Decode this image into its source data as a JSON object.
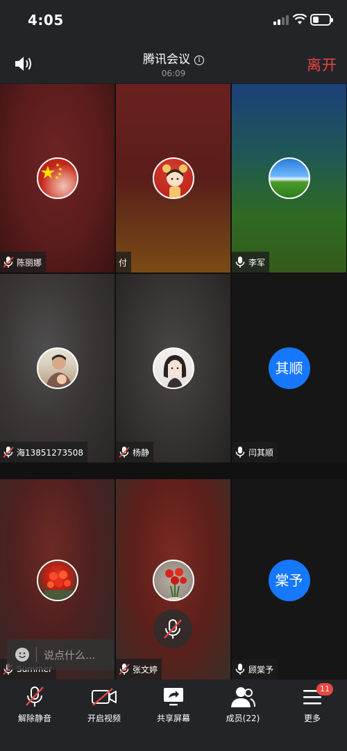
{
  "status_bar": {
    "time": "4:05"
  },
  "meeting": {
    "title": "腾讯会议",
    "info_icon": "i",
    "duration": "06:09",
    "leave_label": "离开"
  },
  "participants": [
    {
      "name": "陈丽娜",
      "mic": "muted",
      "avatar": "photo",
      "avatar_text": ""
    },
    {
      "name": "付",
      "mic": "none",
      "avatar": "photo",
      "avatar_text": ""
    },
    {
      "name": "李军",
      "mic": "on",
      "avatar": "photo",
      "avatar_text": ""
    },
    {
      "name": "海13851273508",
      "mic": "muted",
      "avatar": "photo",
      "avatar_text": ""
    },
    {
      "name": "杨静",
      "mic": "muted",
      "avatar": "photo",
      "avatar_text": ""
    },
    {
      "name": "闫其顺",
      "mic": "on",
      "avatar": "text",
      "avatar_text": "其顺"
    },
    {
      "name": "Summer",
      "mic": "muted",
      "avatar": "photo",
      "avatar_text": ""
    },
    {
      "name": "张文婷",
      "mic": "muted",
      "avatar": "photo",
      "avatar_text": ""
    },
    {
      "name": "顾棠予",
      "mic": "on",
      "avatar": "text",
      "avatar_text": "棠予"
    }
  ],
  "chat": {
    "placeholder": "说点什么..."
  },
  "toolbar": {
    "unmute": "解除静音",
    "video": "开启视频",
    "share": "共享屏幕",
    "members": "成员(22)",
    "more": "更多",
    "more_badge": "11"
  },
  "colors": {
    "leave": "#e8473f",
    "avatar_blue": "#1677ff",
    "muted_red": "#e8473f"
  }
}
